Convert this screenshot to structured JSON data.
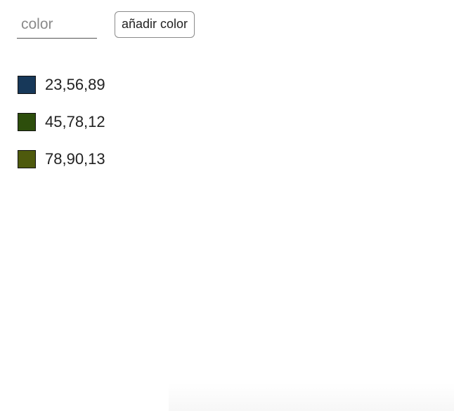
{
  "form": {
    "input_value": "",
    "input_placeholder": "color",
    "add_button_label": "añadir color"
  },
  "colors": [
    {
      "label": "23,56,89",
      "swatch": "#173859"
    },
    {
      "label": "45,78,12",
      "swatch": "#2d4e0c"
    },
    {
      "label": "78,90,13",
      "swatch": "#4e5a0d"
    }
  ]
}
